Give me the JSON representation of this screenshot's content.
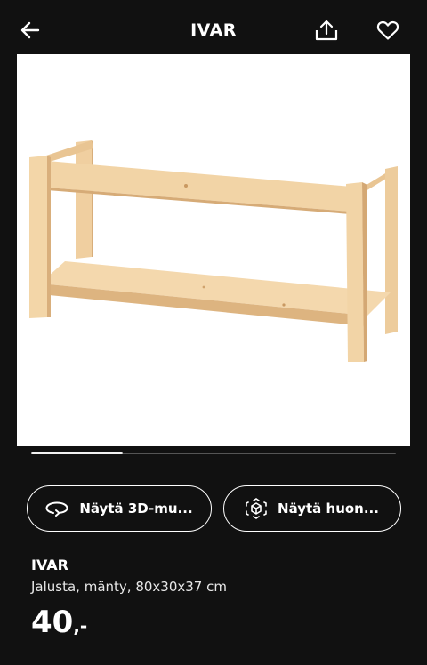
{
  "header": {
    "title": "IVAR",
    "back_icon": "arrow-left-icon",
    "share_icon": "share-upload-icon",
    "favorite_icon": "heart-outline-icon"
  },
  "gallery": {
    "image_subject": "IVAR pine bench frame with lower shelf",
    "progress_fraction": 0.25
  },
  "actions": {
    "view_3d_label": "Näytä 3D-mu...",
    "view_3d_icon": "rotate-3d-icon",
    "view_room_label": "Näytä huon...",
    "view_room_icon": "ar-cube-icon"
  },
  "product": {
    "name": "IVAR",
    "description": "Jalusta, mänty, 80x30x37 cm",
    "price": "40",
    "price_suffix": ",-"
  },
  "colors": {
    "background": "#111111",
    "text": "#ffffff",
    "wood_light": "#f2d3a3",
    "wood_shadow": "#dcb27f"
  }
}
